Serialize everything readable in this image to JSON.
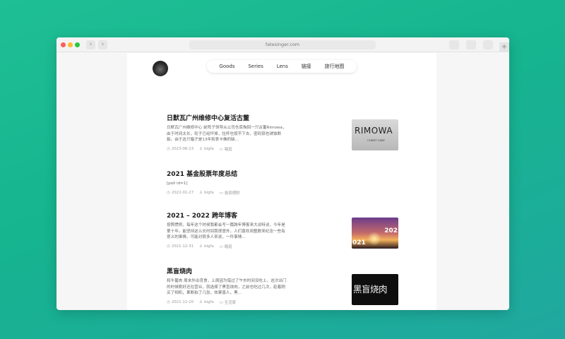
{
  "browser": {
    "url": "fatesinger.com",
    "back_glyph": "‹",
    "forward_glyph": "›",
    "newtab_glyph": "+"
  },
  "nav": {
    "items": [
      "Goods",
      "Series",
      "Lens",
      "链接",
      "旅行地图"
    ]
  },
  "posts": [
    {
      "title": "日默瓦广州维修中心复活古董",
      "excerpt": "日默瓦广州维修中心 前阵子领导从公司仓库掏回一只古董Rimowa，由于时间太长，轮子已经坏掉，拉杆也按不下去，密码锁也锈蚀断裂。由于这只箱子是13年和表卡佛的缺...",
      "date": "2023-06-23",
      "author": "bigfa",
      "category": "瞎逛",
      "thumb_text": "RIMOWA",
      "thumb_sub": "CLIENT CARE"
    },
    {
      "title": "2021 基金股票年度总结",
      "excerpt": "[poll id=1]",
      "date": "2022-01-27",
      "author": "bigfa",
      "category": "投资理财"
    },
    {
      "title": "2021 – 2022 跨年博客",
      "excerpt": "按照惯例，每年这个时候我都会写一篇跨年博客来大谈特谈，今年是第十年。能坚持这么长时间我很意外，人们喜欢用整数来纪念一些有意义的事情，可能对很多人来说，一件事情...",
      "date": "2021-12-31",
      "author": "bigfa",
      "category": "瞎逛",
      "thumb_left": "021",
      "thumb_right": "202"
    },
    {
      "title": "黑盲烧肉",
      "excerpt": "和牛鳌肉 周末外出觅食，上周因为错过了午市时间没吃上，这次出门的时候刚好还在营业，就选择了黑盲烧肉，之前也吃过几次，趁着刚买了相机，果断拍了几张，效果喜人，黑...",
      "date": "2021-12-20",
      "author": "bigfa",
      "category": "生活家",
      "thumb_text": "黑盲烧肉"
    }
  ],
  "icons": {
    "clock": "◷",
    "user": "♙",
    "folder": "▭"
  },
  "colors": {
    "background": "#1fbf95",
    "traffic_red": "#fc5f57",
    "traffic_yellow": "#fdbc2e",
    "traffic_green": "#28c840"
  }
}
